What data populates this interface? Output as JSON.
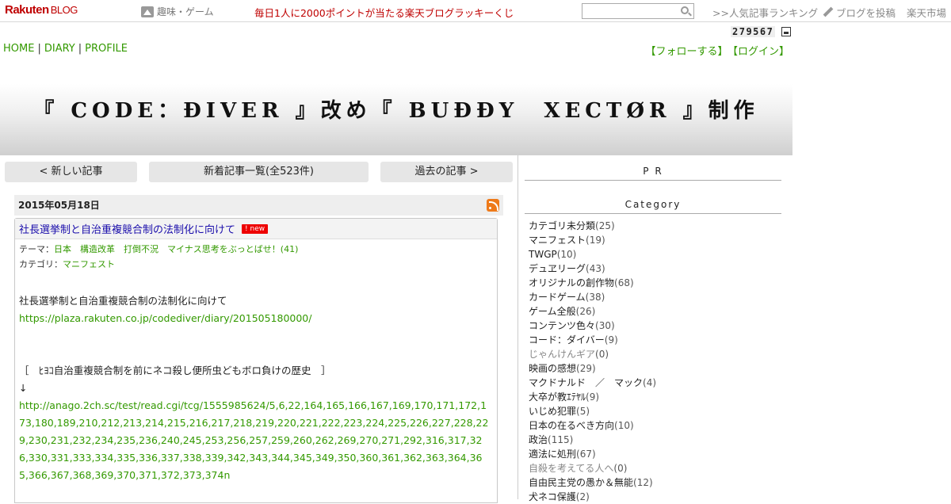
{
  "header": {
    "logo": "Rakuten",
    "logo_suffix": "BLOG",
    "genre": "趣味・ゲーム",
    "lucky": "毎日1人に2000ポイントが当たる楽天ブログラッキーくじ",
    "search_placeholder": "",
    "ranking": ">>人気記事ランキング",
    "write": "ブログを投稿",
    "ichiba": "楽天市場"
  },
  "counter": "279567",
  "nav": {
    "home": "HOME",
    "diary": "DIARY",
    "profile": "PROFILE",
    "sep": "|"
  },
  "follow": {
    "follow": "【フォローする】",
    "login": "【ログイン】"
  },
  "title": "『 CODE：ĐIVER 』改め『 BUĐĐY　XECTØR 』制作",
  "pager": {
    "newer": "< 新しい記事",
    "list": "新着記事一覧(全523件)",
    "older": "過去の記事 >"
  },
  "date": "2015年05月18日",
  "article": {
    "title": "社長選挙制と自治重複競合制の法制化に向けて",
    "new_badge": "! new",
    "theme_label": "テーマ：",
    "theme": "日本　構造改革　打倒不況　マイナス思考をぶっとばせ！(41)",
    "category_label": "カテゴリ：",
    "category": "マニフェスト",
    "line1": "社長選挙制と自治重複競合制の法制化に向けて",
    "link1": "https://plaza.rakuten.co.jp/codediver/diary/201505180000/",
    "line2": "［　ﾋﾖｺ自治重複競合制を前にネコ殺し便所虫どもボロ負けの歴史　］",
    "arrow": "↓",
    "link2": "http://anago.2ch.sc/test/read.cgi/tcg/1555985624/5,6,22,164,165,166,167,169,170,171,172,173,180,189,210,212,213,214,215,216,217,218,219,220,221,222,223,224,225,226,227,228,229,230,231,232,234,235,236,240,245,253,256,257,259,260,262,269,270,271,292,316,317,326,330,331,333,334,335,336,337,338,339,342,343,344,345,349,350,360,361,362,363,364,365,366,367,368,369,370,371,372,373,374n"
  },
  "sidebar": {
    "pr": "P R",
    "category_head": "Category",
    "categories": [
      {
        "name": "カテゴリ未分類",
        "count": "(25)"
      },
      {
        "name": "マニフェスト",
        "count": "(19)"
      },
      {
        "name": "TWGP",
        "count": "(10)"
      },
      {
        "name": "デュヱリーグ",
        "count": "(43)"
      },
      {
        "name": "オリジナルの創作物",
        "count": "(68)"
      },
      {
        "name": "カードゲーム",
        "count": "(38)"
      },
      {
        "name": "ゲーム全般",
        "count": "(26)"
      },
      {
        "name": "コンテンツ色々",
        "count": "(30)"
      },
      {
        "name": "コード：ダイバー",
        "count": "(9)"
      },
      {
        "name": "じゃんけんギア",
        "count": "(0)"
      },
      {
        "name": "映画の感想",
        "count": "(29)"
      },
      {
        "name": "マクドナルド　／　マック",
        "count": "(4)"
      },
      {
        "name": "大卒が教ｴﾃﾔﾙ",
        "count": "(9)"
      },
      {
        "name": "いじめ犯罪",
        "count": "(5)"
      },
      {
        "name": "日本の在るべき方向",
        "count": "(10)"
      },
      {
        "name": "政治",
        "count": "(115)"
      },
      {
        "name": "適法に処刑",
        "count": "(67)"
      },
      {
        "name": "自殺を考えてる人へ",
        "count": "(0)"
      },
      {
        "name": "自由民主党の愚か＆無能",
        "count": "(12)"
      },
      {
        "name": "犬ネコ保護",
        "count": "(2)"
      }
    ]
  }
}
